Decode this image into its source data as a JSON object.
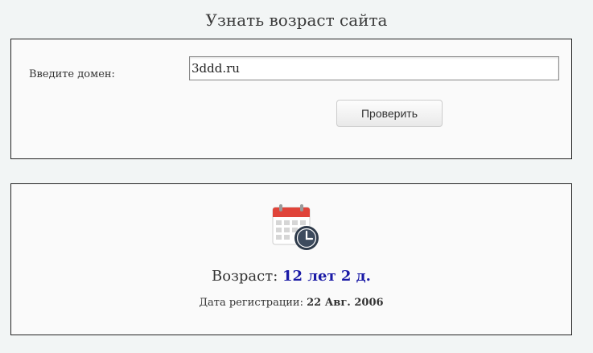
{
  "page": {
    "title": "Узнать возраст сайта"
  },
  "form": {
    "domain_label": "Введите домен:",
    "domain_value": "3ddd.ru",
    "check_button": "Проверить"
  },
  "result": {
    "icon": "calendar-clock-icon",
    "age_label": "Возраст:",
    "age_value": "12 лет 2 д.",
    "reg_label": "Дата регистрации:",
    "reg_value": "22 Авг. 2006"
  },
  "colors": {
    "age_value": "#1a1aa6",
    "calendar_header": "#e0443a",
    "clock": "#2e3a4a"
  }
}
